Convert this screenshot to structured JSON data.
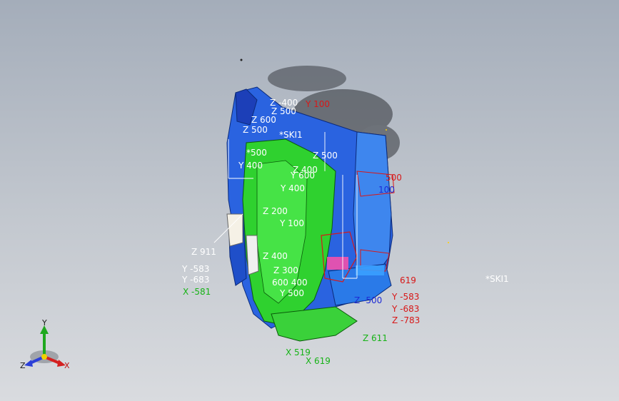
{
  "window": {
    "title": ""
  },
  "viewport": {
    "sketch_tags": [
      "*SKI1",
      "*SKI1"
    ],
    "dimension_labels": [
      {
        "text": "Z -400",
        "color": "white"
      },
      {
        "text": "Z 500",
        "color": "white"
      },
      {
        "text": "Z 600",
        "color": "white"
      },
      {
        "text": "Z 500",
        "color": "white"
      },
      {
        "text": "*500",
        "color": "white"
      },
      {
        "text": "Y 400",
        "color": "white"
      },
      {
        "text": "Z 500",
        "color": "white"
      },
      {
        "text": "Z 400",
        "color": "white"
      },
      {
        "text": "Y 400",
        "color": "white"
      },
      {
        "text": "Z 200",
        "color": "white"
      },
      {
        "text": "Y 100",
        "color": "white"
      },
      {
        "text": "Z 911",
        "color": "white"
      },
      {
        "text": "Y -583",
        "color": "white"
      },
      {
        "text": "Y -683",
        "color": "white"
      },
      {
        "text": "Z 400",
        "color": "white"
      },
      {
        "text": "Z 300",
        "color": "white"
      },
      {
        "text": "600 400",
        "color": "white"
      },
      {
        "text": "Y 500",
        "color": "white"
      },
      {
        "text": "Y 600",
        "color": "white"
      },
      {
        "text": "X -581",
        "color": "green"
      },
      {
        "text": "X 519",
        "color": "green"
      },
      {
        "text": "X 619",
        "color": "green"
      },
      {
        "text": "Z 611",
        "color": "green"
      },
      {
        "text": "Y -583",
        "color": "red"
      },
      {
        "text": "Y -683",
        "color": "red"
      },
      {
        "text": "Z -783",
        "color": "red"
      },
      {
        "text": "619",
        "color": "red"
      },
      {
        "text": "500",
        "color": "red"
      },
      {
        "text": "Y 100",
        "color": "red"
      },
      {
        "text": "Z -500",
        "color": "blue"
      },
      {
        "text": "100",
        "color": "blue"
      }
    ]
  },
  "triad": {
    "x_label": "X",
    "y_label": "Y",
    "z_label": "Z"
  },
  "colors": {
    "background_top": "#a4adba",
    "model_green": "#2fd12f",
    "model_blue": "#2a63e0",
    "model_white": "#f0f0f0",
    "dim_red": "#d81818",
    "dim_green": "#17b317",
    "dim_blue": "#1d2bd6"
  }
}
